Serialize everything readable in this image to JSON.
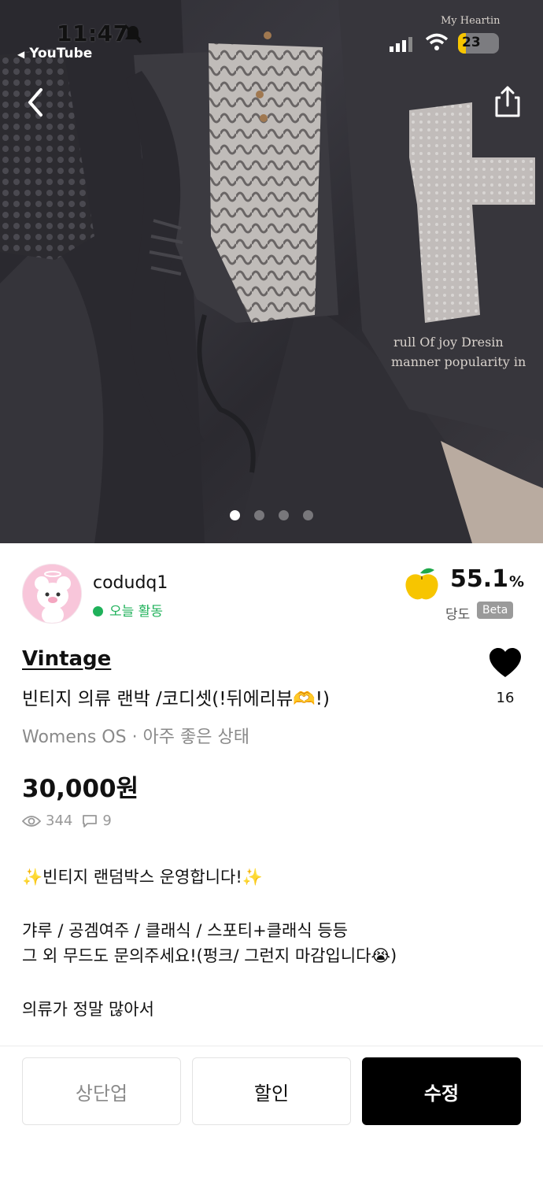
{
  "status_bar": {
    "time": "11:47",
    "back_app": "YouTube",
    "battery": "23"
  },
  "carousel": {
    "total": 4,
    "active_index": 0
  },
  "seller": {
    "username": "codudq1",
    "activity": "오늘 활동",
    "sweetness_value": "55.1",
    "sweetness_unit": "%",
    "sweetness_label": "당도",
    "beta_badge": "Beta"
  },
  "product": {
    "brand": "Vintage",
    "title": "빈티지 의류 랜박 /코디셋(!뒤에리뷰🫶!)",
    "meta": "Womens OS · 아주 좋은 상태",
    "price": "30,000원",
    "views": "344",
    "comments": "9",
    "likes": "16"
  },
  "description": {
    "line1": "✨빈티지 랜덤박스 운영합니다!✨",
    "line2": "갸루 / 공겜여주 / 클래식 / 스포티+클래식 등등",
    "line3": "그 외 무드도 문의주세요!(펑크/ 그런지 마감입니다😭)",
    "line4": "의류가 정말 많아서"
  },
  "actions": {
    "bump": "상단업",
    "discount": "할인",
    "edit": "수정"
  }
}
